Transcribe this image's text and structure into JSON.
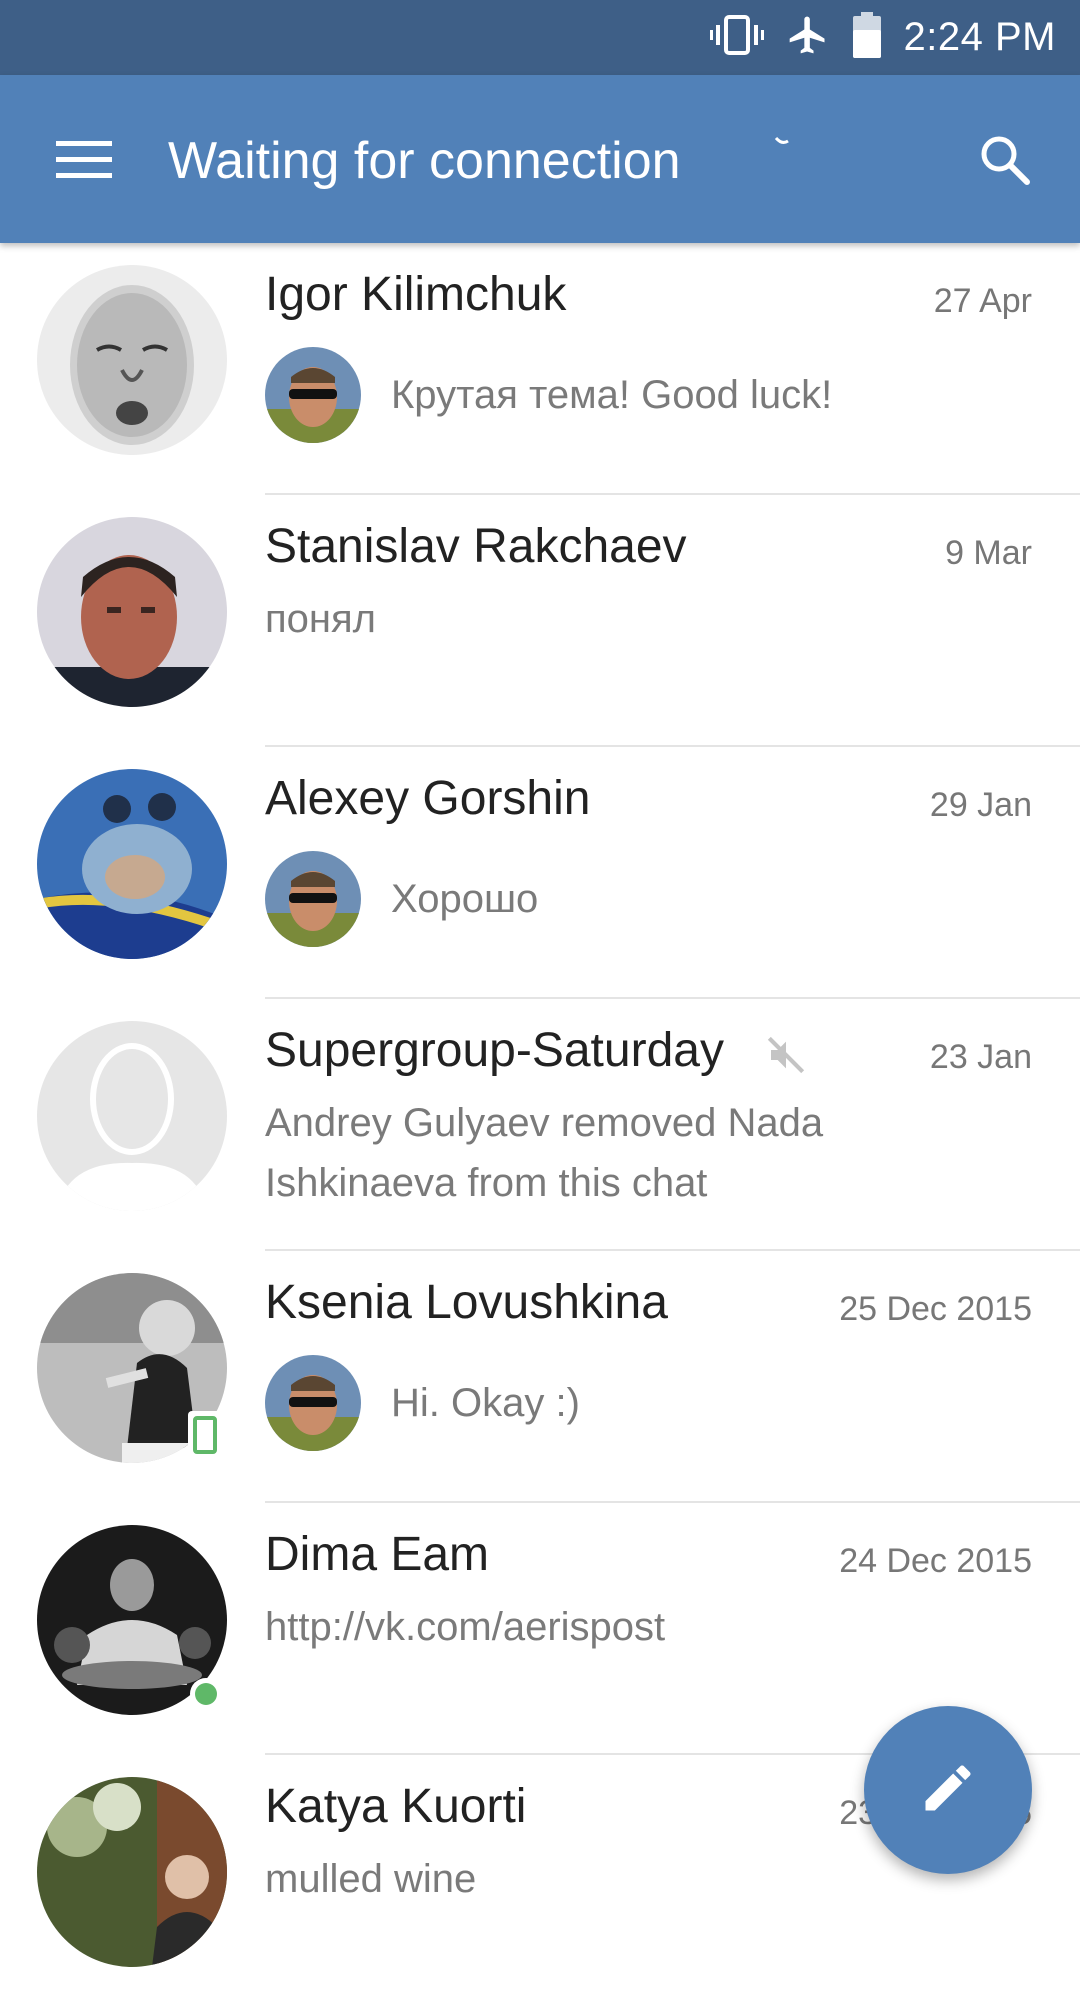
{
  "status_bar": {
    "time": "2:24 PM",
    "icons": [
      "vibrate-icon",
      "airplane-mode-icon",
      "battery-icon"
    ]
  },
  "toolbar": {
    "title": "Waiting for connection",
    "menu_icon": "hamburger-menu-icon",
    "search_icon": "search-icon",
    "background": "#5181b8"
  },
  "chats": [
    {
      "name": "Igor Kilimchuk",
      "date": "27 Apr",
      "preview": "Крутая тема! Good luck!",
      "own_message": true
    },
    {
      "name": "Stanislav Rakchaev",
      "date": "9 Mar",
      "preview": "понял",
      "own_message": false
    },
    {
      "name": "Alexey Gorshin",
      "date": "29 Jan",
      "preview": "Хорошо",
      "own_message": true
    },
    {
      "name": "Supergroup-Saturday",
      "date": "23 Jan",
      "preview": "Andrey Gulyaev removed Nada Ishkinaeva from this chat",
      "own_message": false,
      "muted": true
    },
    {
      "name": "Ksenia Lovushkina",
      "date": "25 Dec 2015",
      "preview": "Hi. Okay :)",
      "own_message": true,
      "status": "mobile-online"
    },
    {
      "name": "Dima Eam",
      "date": "24 Dec 2015",
      "preview": "http://vk.com/aerispost",
      "own_message": false,
      "status": "online"
    },
    {
      "name": "Katya Kuorti",
      "date": "23 Dec 2015",
      "preview": "mulled wine",
      "own_message": false
    }
  ],
  "fab": {
    "icon": "pencil-icon",
    "color": "#5181b8"
  },
  "colors": {
    "status_bar": "#3e5f87",
    "online": "#5fb868",
    "name_text": "#222222",
    "secondary_text": "#7a7a7a"
  }
}
